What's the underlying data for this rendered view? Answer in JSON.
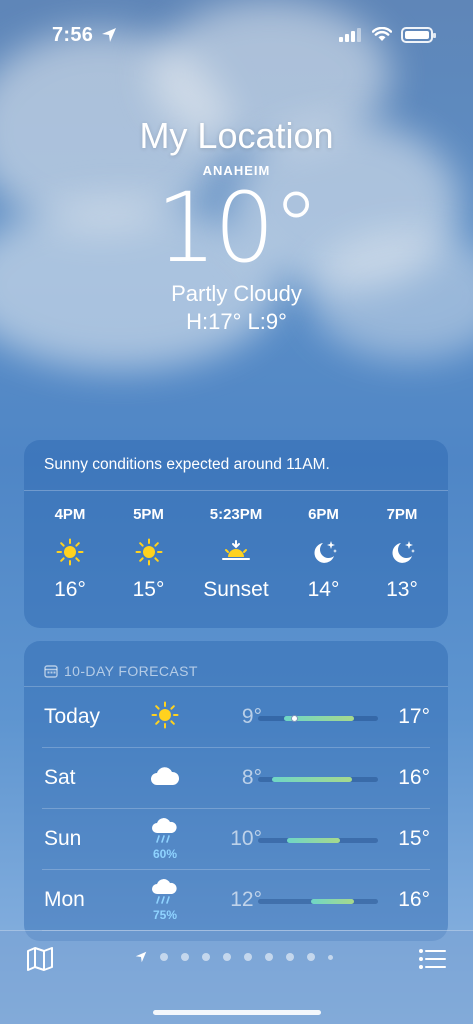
{
  "status_bar": {
    "time": "7:56"
  },
  "header": {
    "title": "My Location",
    "subtitle": "ANAHEIM",
    "temperature": "10°",
    "condition": "Partly Cloudy",
    "high_low": "H:17°  L:9°"
  },
  "hourly": {
    "message": "Sunny conditions expected around 11AM.",
    "items": [
      {
        "label": "4PM",
        "icon": "sun-icon",
        "temp": "16°"
      },
      {
        "label": "5PM",
        "icon": "sun-icon",
        "temp": "15°"
      },
      {
        "label": "5:23PM",
        "icon": "sunset-icon",
        "temp": "Sunset"
      },
      {
        "label": "6PM",
        "icon": "moon-stars-icon",
        "temp": "14°"
      },
      {
        "label": "7PM",
        "icon": "moon-stars-icon",
        "temp": "13°"
      }
    ]
  },
  "daily": {
    "heading": "10-DAY FORECAST",
    "days": [
      {
        "name": "Today",
        "icon": "sun-icon",
        "precip": "",
        "low": "9°",
        "high": "17°",
        "range_start": 0.22,
        "range_end": 0.8,
        "current": 0.3
      },
      {
        "name": "Sat",
        "icon": "cloud-icon",
        "precip": "",
        "low": "8°",
        "high": "16°",
        "range_start": 0.12,
        "range_end": 0.78
      },
      {
        "name": "Sun",
        "icon": "cloud-rain-icon",
        "precip": "60%",
        "low": "10°",
        "high": "15°",
        "range_start": 0.24,
        "range_end": 0.68
      },
      {
        "name": "Mon",
        "icon": "cloud-rain-icon",
        "precip": "75%",
        "low": "12°",
        "high": "16°",
        "range_start": 0.44,
        "range_end": 0.8
      }
    ]
  },
  "colors": {
    "sun": "#ffd21f",
    "precip": "#8fd3ff",
    "range_start": "#6fd6c6",
    "range_end": "#a7d98c"
  },
  "bottom_bar": {
    "page_count": 9,
    "active_page": 0
  }
}
